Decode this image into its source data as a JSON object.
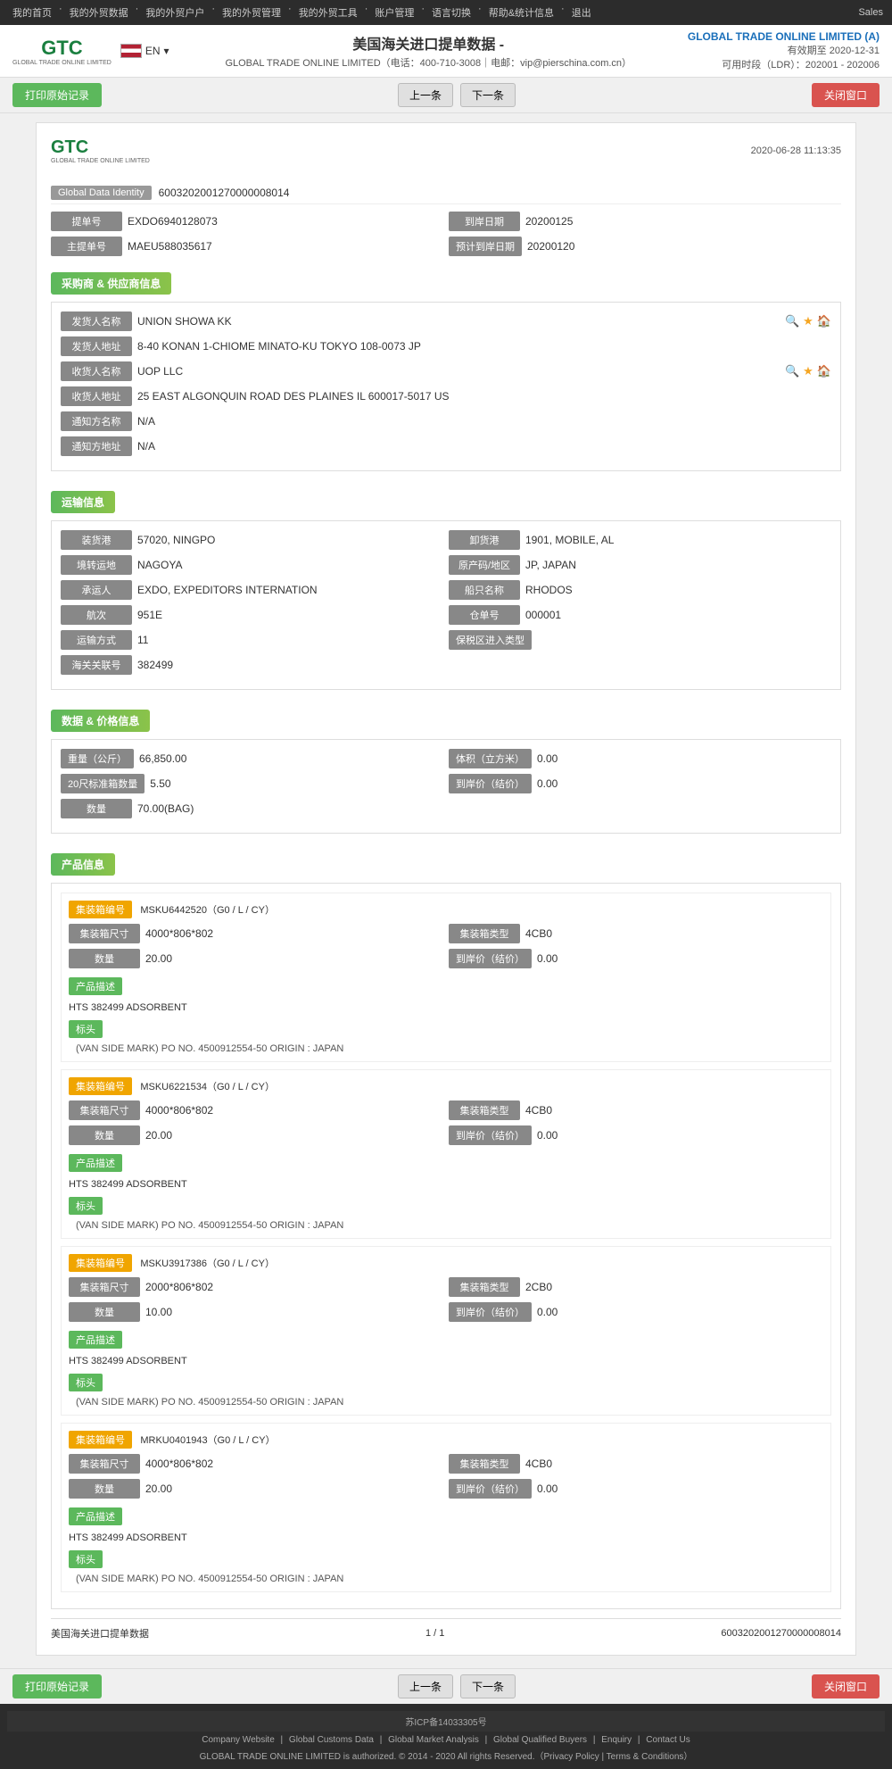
{
  "nav": {
    "links": [
      "我的首页",
      "我的外贸数据",
      "我的外贸户户",
      "我的外贸管理",
      "我的外贸工具",
      "账户管理",
      "语言切换",
      "帮助&统计信息",
      "退出"
    ],
    "sales": "Sales"
  },
  "header": {
    "logo_main": "GTC",
    "logo_sub": "GLOBAL TRADE ONLINE LIMITED",
    "flag_alt": "US Flag",
    "lang": "EN",
    "page_title": "美国海关进口提单数据 -",
    "company_info": "GLOBAL TRADE ONLINE LIMITED（电话：400-710-3008｜电邮：vip@pierschina.com.cn）",
    "brand_name": "GLOBAL TRADE ONLINE LIMITED (A)",
    "expiry": "有效期至 2020-12-31",
    "ldr": "可用时段（LDR）：202001 - 202006"
  },
  "toolbar": {
    "print_label": "打印原始记录",
    "prev_label": "上一条",
    "next_label": "下一条",
    "close_label": "关闭窗口"
  },
  "document": {
    "logo": "GTC",
    "logo_sub": "GLOBAL TRADE ONLINE LIMITED",
    "timestamp": "2020-06-28 11:13:35",
    "gdi_label": "Global Data Identity",
    "gdi_value": "6003202001270000008014",
    "fields": {
      "bill_no_label": "提单号",
      "bill_no_value": "EXDO6940128073",
      "customs_date_label": "到岸日期",
      "customs_date_value": "20200125",
      "master_bill_label": "主提单号",
      "master_bill_value": "MAEU588035617",
      "planned_date_label": "预计到岸日期",
      "planned_date_value": "20200120"
    },
    "sections": {
      "buyer_supplier": {
        "title": "采购商 & 供应商信息",
        "shipper_name_label": "发货人名称",
        "shipper_name_value": "UNION SHOWA KK",
        "shipper_addr_label": "发货人地址",
        "shipper_addr_value": "8-40 KONAN 1-CHIOME MINATO-KU TOKYO 108-0073 JP",
        "consignee_name_label": "收货人名称",
        "consignee_name_value": "UOP LLC",
        "consignee_addr_label": "收货人地址",
        "consignee_addr_value": "25 EAST ALGONQUIN ROAD DES PLAINES IL 600017-5017 US",
        "notify_name_label": "通知方名称",
        "notify_name_value": "N/A",
        "notify_addr_label": "通知方地址",
        "notify_addr_value": "N/A"
      },
      "transport": {
        "title": "运输信息",
        "loading_port_label": "装货港",
        "loading_port_value": "57020, NINGPO",
        "unloading_port_label": "卸货港",
        "unloading_port_value": "1901, MOBILE, AL",
        "transit_place_label": "境转运地",
        "transit_place_value": "NAGOYA",
        "origin_label": "原产码/地区",
        "origin_value": "JP, JAPAN",
        "forwarder_label": "承运人",
        "forwarder_value": "EXDO, EXPEDITORS INTERNATION",
        "ship_name_label": "船只名称",
        "ship_name_value": "RHODOS",
        "voyage_label": "航次",
        "voyage_value": "951E",
        "bill_lading_label": "仓单号",
        "bill_lading_value": "000001",
        "transport_mode_label": "运输方式",
        "transport_mode_value": "11",
        "insurance_label": "保税区进入类型",
        "insurance_value": "",
        "customs_no_label": "海关关联号",
        "customs_no_value": "382499"
      },
      "data_price": {
        "title": "数据 & 价格信息",
        "weight_label": "重量（公斤）",
        "weight_value": "66,850.00",
        "volume_label": "体积（立方米）",
        "volume_value": "0.00",
        "container_20_label": "20尺标准箱数量",
        "container_20_value": "5.50",
        "unit_price_label": "到岸价（结价）",
        "unit_price_value": "0.00",
        "quantity_label": "数量",
        "quantity_value": "70.00(BAG)"
      },
      "product": {
        "title": "产品信息",
        "items": [
          {
            "container_no_label": "集装箱编号",
            "container_no_value": "MSKU6442520（G0 / L / CY）",
            "size_label": "集装箱尺寸",
            "size_value": "4000*806*802",
            "type_label": "集装箱类型",
            "type_value": "4CB0",
            "quantity_label": "数量",
            "quantity_value": "20.00",
            "unit_price_label": "到岸价（结价）",
            "unit_price_value": "0.00",
            "desc_label": "产品描述",
            "desc_value": "HTS 382499 ADSORBENT",
            "mark_label": "标头",
            "mark_value": "(VAN SIDE MARK) PO NO. 4500912554-50 ORIGIN : JAPAN"
          },
          {
            "container_no_label": "集装箱编号",
            "container_no_value": "MSKU6221534（G0 / L / CY）",
            "size_label": "集装箱尺寸",
            "size_value": "4000*806*802",
            "type_label": "集装箱类型",
            "type_value": "4CB0",
            "quantity_label": "数量",
            "quantity_value": "20.00",
            "unit_price_label": "到岸价（结价）",
            "unit_price_value": "0.00",
            "desc_label": "产品描述",
            "desc_value": "HTS 382499 ADSORBENT",
            "mark_label": "标头",
            "mark_value": "(VAN SIDE MARK) PO NO. 4500912554-50 ORIGIN : JAPAN"
          },
          {
            "container_no_label": "集装箱编号",
            "container_no_value": "MSKU3917386（G0 / L / CY）",
            "size_label": "集装箱尺寸",
            "size_value": "2000*806*802",
            "type_label": "集装箱类型",
            "type_value": "2CB0",
            "quantity_label": "数量",
            "quantity_value": "10.00",
            "unit_price_label": "到岸价（结价）",
            "unit_price_value": "0.00",
            "desc_label": "产品描述",
            "desc_value": "HTS 382499 ADSORBENT",
            "mark_label": "标头",
            "mark_value": "(VAN SIDE MARK) PO NO. 4500912554-50 ORIGIN : JAPAN"
          },
          {
            "container_no_label": "集装箱编号",
            "container_no_value": "MRKU0401943（G0 / L / CY）",
            "size_label": "集装箱尺寸",
            "size_value": "4000*806*802",
            "type_label": "集装箱类型",
            "type_value": "4CB0",
            "quantity_label": "数量",
            "quantity_value": "20.00",
            "unit_price_label": "到岸价（结价）",
            "unit_price_value": "0.00",
            "desc_label": "产品描述",
            "desc_value": "HTS 382499 ADSORBENT",
            "mark_label": "标头",
            "mark_value": "(VAN SIDE MARK) PO NO. 4500912554-50 ORIGIN : JAPAN"
          }
        ]
      }
    },
    "footer": {
      "source_label": "美国海关进口提单数据",
      "page": "1 / 1",
      "gdi": "6003202001270000008014"
    }
  },
  "site_footer": {
    "beian": "苏ICP备14033305号",
    "links": [
      "Company Website",
      "Global Customs Data",
      "Global Market Analysis",
      "Global Qualified Buyers",
      "Enquiry",
      "Contact Us"
    ],
    "copyright": "GLOBAL TRADE ONLINE LIMITED is authorized. © 2014 - 2020 All rights Reserved.（Privacy Policy | Terms & Conditions）"
  }
}
